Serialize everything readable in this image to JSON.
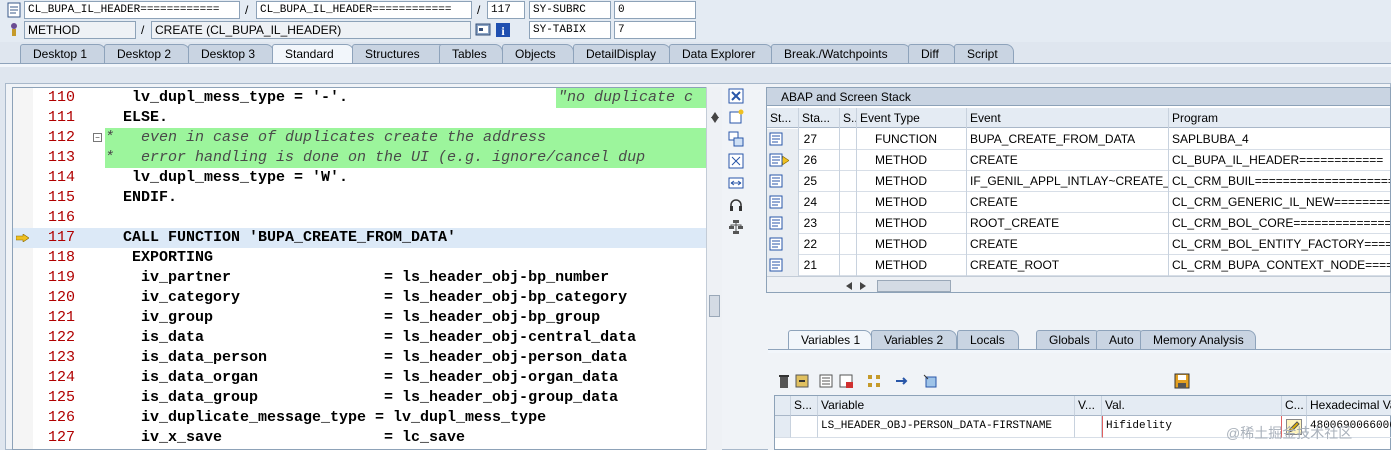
{
  "header": {
    "row1": {
      "class_field": "CL_BUPA_IL_HEADER============",
      "include_field": "CL_BUPA_IL_HEADER============",
      "line_no": "117",
      "sysvar_label": "SY-SUBRC",
      "sysvar_value": "0"
    },
    "row2": {
      "type_field": "METHOD",
      "name_field": "CREATE (CL_BUPA_IL_HEADER)",
      "sysvar_label": "SY-TABIX",
      "sysvar_value": "7"
    },
    "separator": "/"
  },
  "tabs": [
    "Desktop 1",
    "Desktop 2",
    "Desktop 3",
    "Standard",
    "Structures",
    "Tables",
    "Objects",
    "DetailDisplay",
    "Data Explorer",
    "Break./Watchpoints",
    "Diff",
    "Script"
  ],
  "active_tab": "Standard",
  "editor": {
    "lines": [
      {
        "num": "110",
        "indent": "   ",
        "text": "lv_dupl_mess_type = '-'.",
        "type": "code",
        "trail": "\"no duplicate c"
      },
      {
        "num": "111",
        "indent": "  ",
        "text": "ELSE.",
        "type": "keyword"
      },
      {
        "num": "112",
        "indent": "",
        "text": "*   even in case of duplicates create the address",
        "type": "comment"
      },
      {
        "num": "113",
        "indent": "",
        "text": "*   error handling is done on the UI (e.g. ignore/cancel dup",
        "type": "comment"
      },
      {
        "num": "114",
        "indent": "   ",
        "text": "lv_dupl_mess_type = 'W'.",
        "type": "code"
      },
      {
        "num": "115",
        "indent": "  ",
        "text": "ENDIF.",
        "type": "keyword"
      },
      {
        "num": "116",
        "indent": "",
        "text": "",
        "type": "code"
      },
      {
        "num": "117",
        "indent": "  ",
        "text": "CALL FUNCTION 'BUPA_CREATE_FROM_DATA'",
        "type": "call"
      },
      {
        "num": "118",
        "indent": "   ",
        "text": "EXPORTING",
        "type": "keyword"
      },
      {
        "num": "119",
        "indent": "    ",
        "text": "iv_partner                 = ls_header_obj-bp_number",
        "type": "code"
      },
      {
        "num": "120",
        "indent": "    ",
        "text": "iv_category                = ls_header_obj-bp_category",
        "type": "code"
      },
      {
        "num": "121",
        "indent": "    ",
        "text": "iv_group                   = ls_header_obj-bp_group",
        "type": "code"
      },
      {
        "num": "122",
        "indent": "    ",
        "text": "is_data                    = ls_header_obj-central_data",
        "type": "code"
      },
      {
        "num": "123",
        "indent": "    ",
        "text": "is_data_person             = ls_header_obj-person_data",
        "type": "code"
      },
      {
        "num": "124",
        "indent": "    ",
        "text": "is_data_organ              = ls_header_obj-organ_data",
        "type": "code"
      },
      {
        "num": "125",
        "indent": "    ",
        "text": "is_data_group              = ls_header_obj-group_data",
        "type": "code"
      },
      {
        "num": "126",
        "indent": "    ",
        "text": "iv_duplicate_message_type = lv_dupl_mess_type",
        "type": "code"
      },
      {
        "num": "127",
        "indent": "    ",
        "text": "iv_x_save                  = lc_save",
        "type": "code"
      }
    ],
    "current_line": "117"
  },
  "stack": {
    "title": "ABAP and Screen Stack",
    "columns": [
      "St...",
      "Sta...",
      "S...",
      "Event Type",
      "Event",
      "Program"
    ],
    "rows": [
      {
        "level": "27",
        "type": "FUNCTION",
        "event": "BUPA_CREATE_FROM_DATA",
        "program": "SAPLBUBA_4",
        "current": false
      },
      {
        "level": "26",
        "type": "METHOD",
        "event": "CREATE",
        "program": "CL_BUPA_IL_HEADER============",
        "current": true
      },
      {
        "level": "25",
        "type": "METHOD",
        "event": "IF_GENIL_APPL_INTLAY~CREATE_...",
        "program": "CL_CRM_BUIL====================",
        "current": false
      },
      {
        "level": "24",
        "type": "METHOD",
        "event": "CREATE",
        "program": "CL_CRM_GENERIC_IL_NEW========",
        "current": false
      },
      {
        "level": "23",
        "type": "METHOD",
        "event": "ROOT_CREATE",
        "program": "CL_CRM_BOL_CORE================",
        "current": false
      },
      {
        "level": "22",
        "type": "METHOD",
        "event": "CREATE",
        "program": "CL_CRM_BOL_ENTITY_FACTORY=====",
        "current": false
      },
      {
        "level": "21",
        "type": "METHOD",
        "event": "CREATE_ROOT",
        "program": "CL_CRM_BUPA_CONTEXT_NODE=====",
        "current": false
      }
    ]
  },
  "vartabs": [
    "Variables 1",
    "Variables 2",
    "Locals",
    "Globals",
    "Auto",
    "Memory Analysis"
  ],
  "active_vartab": "Variables 1",
  "variables": {
    "columns": [
      "S...",
      "Variable",
      "V...",
      "Val.",
      "C...",
      "Hexadecimal Va"
    ],
    "rows": [
      {
        "variable": "LS_HEADER_OBJ-PERSON_DATA-FIRSTNAME",
        "value": "Hifidelity",
        "hex": "4800690066006"
      }
    ]
  },
  "watermark": "@稀土掘金技术社区"
}
